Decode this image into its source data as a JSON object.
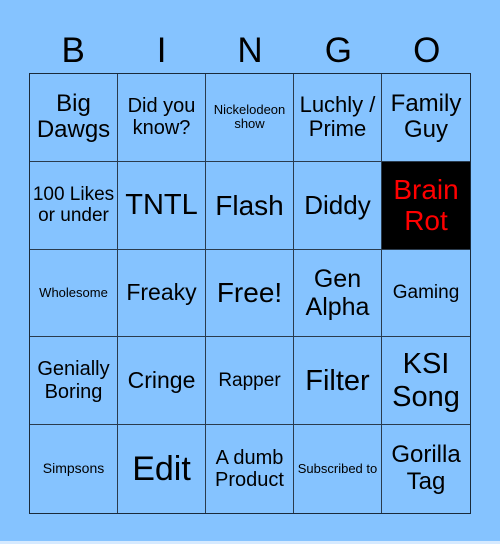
{
  "card": {
    "header_letters": [
      "B",
      "I",
      "N",
      "G",
      "O"
    ],
    "colors": {
      "background": "#85c3ff",
      "grid_line": "#2a3b4d",
      "marked_cell_bg": "#000000",
      "marked_cell_text": "#ff0000"
    },
    "cells": [
      {
        "text": "Big Dawgs",
        "marked": false
      },
      {
        "text": "Did you know?",
        "marked": false
      },
      {
        "text": "Nickelodeon show",
        "marked": false
      },
      {
        "text": "Luchly / Prime",
        "marked": false
      },
      {
        "text": "Family Guy",
        "marked": false
      },
      {
        "text": "100 Likes or under",
        "marked": false
      },
      {
        "text": "TNTL",
        "marked": false
      },
      {
        "text": "Flash",
        "marked": false
      },
      {
        "text": "Diddy",
        "marked": false
      },
      {
        "text": "Brain Rot",
        "marked": true
      },
      {
        "text": "Wholesome",
        "marked": false
      },
      {
        "text": "Freaky",
        "marked": false
      },
      {
        "text": "Free!",
        "marked": false
      },
      {
        "text": "Gen Alpha",
        "marked": false
      },
      {
        "text": "Gaming",
        "marked": false
      },
      {
        "text": "Genially Boring",
        "marked": false
      },
      {
        "text": "Cringe",
        "marked": false
      },
      {
        "text": "Rapper",
        "marked": false
      },
      {
        "text": "Filter",
        "marked": false
      },
      {
        "text": "KSI Song",
        "marked": false
      },
      {
        "text": "Simpsons",
        "marked": false
      },
      {
        "text": "Edit",
        "marked": false
      },
      {
        "text": "A dumb Product",
        "marked": false
      },
      {
        "text": "Subscribed to",
        "marked": false
      },
      {
        "text": "Gorilla Tag",
        "marked": false
      }
    ]
  }
}
